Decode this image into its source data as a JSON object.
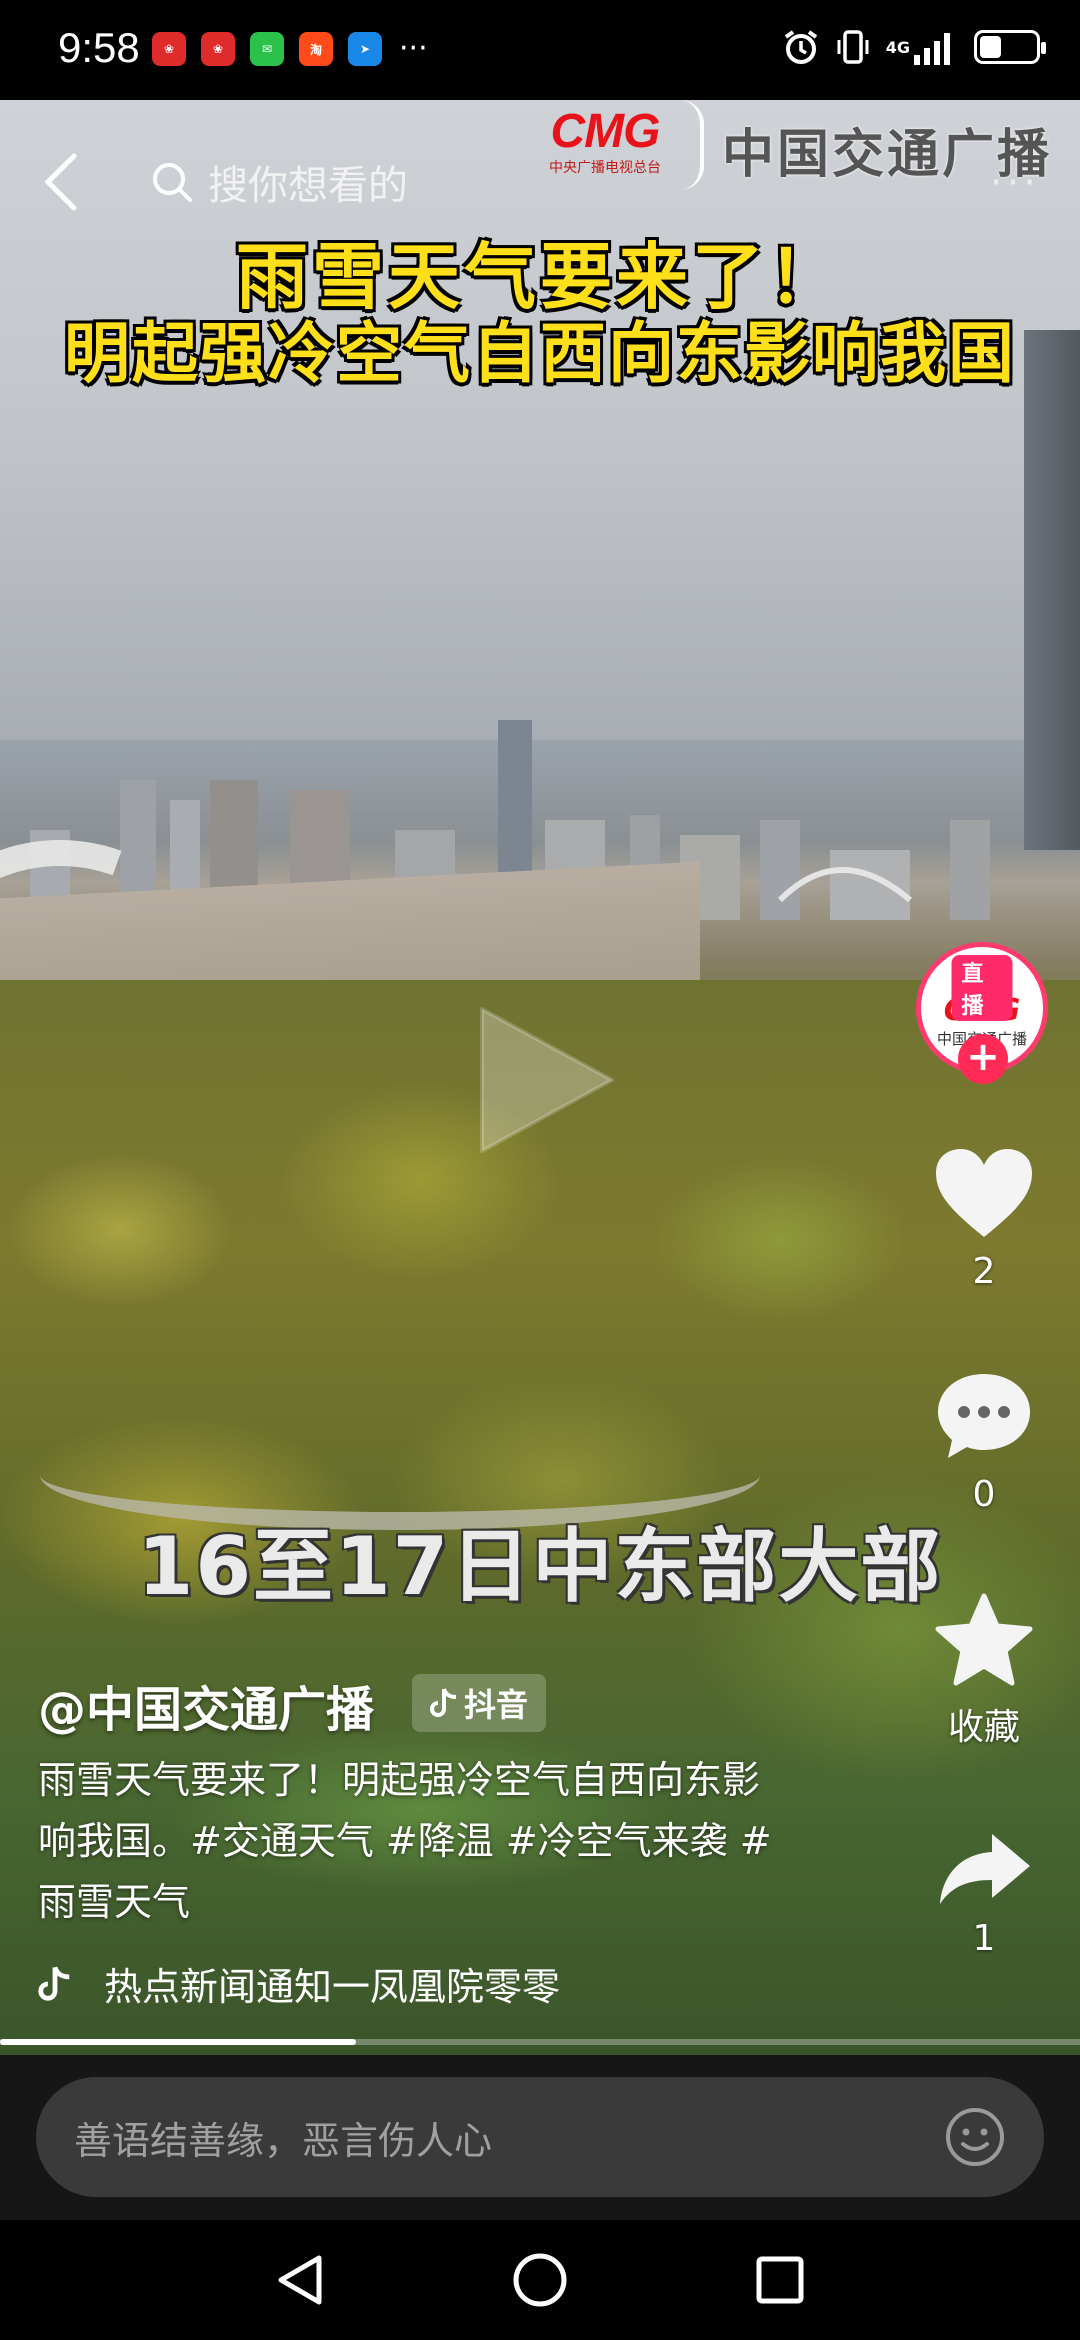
{
  "status_bar": {
    "time": "9:58",
    "app_icons": [
      {
        "name": "huawei-app-icon",
        "color": "#e02b2b",
        "glyph": "❀"
      },
      {
        "name": "huawei-app-icon",
        "color": "#e02b2b",
        "glyph": "❀"
      },
      {
        "name": "wechat-icon",
        "color": "#2bc14a",
        "glyph": "✉"
      },
      {
        "name": "taobao-icon",
        "color": "#ff4a1a",
        "glyph": "淘"
      },
      {
        "name": "messenger-icon",
        "color": "#1a88e8",
        "glyph": "➤"
      }
    ],
    "more": "···",
    "network": "4G",
    "battery_level": 0.45
  },
  "video": {
    "search_placeholder": "搜你想看的",
    "cmg_logo": "CMG",
    "cmg_sub": "中央广播电视总台",
    "channel_name": "中国交通广播",
    "headline_1": "雨雪天气要来了！",
    "headline_2": "明起强冷空气自西向东影响我国",
    "subtitle": "16至17日中东部大部",
    "more": "···"
  },
  "rail": {
    "live_badge": "直播",
    "avatar_brand": "CMG",
    "avatar_name": "中国交通广播",
    "follow": "+",
    "likes": "2",
    "comments": "0",
    "favorite_label": "收藏",
    "shares": "1"
  },
  "caption": {
    "author": "@中国交通广播",
    "platform_tag": "抖音",
    "description": "雨雪天气要来了！明起强冷空气自西向东影响我国。#交通天气 #降温 #冷空气来袭 #雨雪天气",
    "music": "热点新闻通知一凤凰院零零"
  },
  "progress": 0.33,
  "comment_bar": {
    "placeholder": "善语结善缘，恶言伤人心"
  },
  "colors": {
    "accent": "#ff2a56",
    "headline_yellow": "#ffdf1a",
    "cmg_red": "#e8121a"
  }
}
